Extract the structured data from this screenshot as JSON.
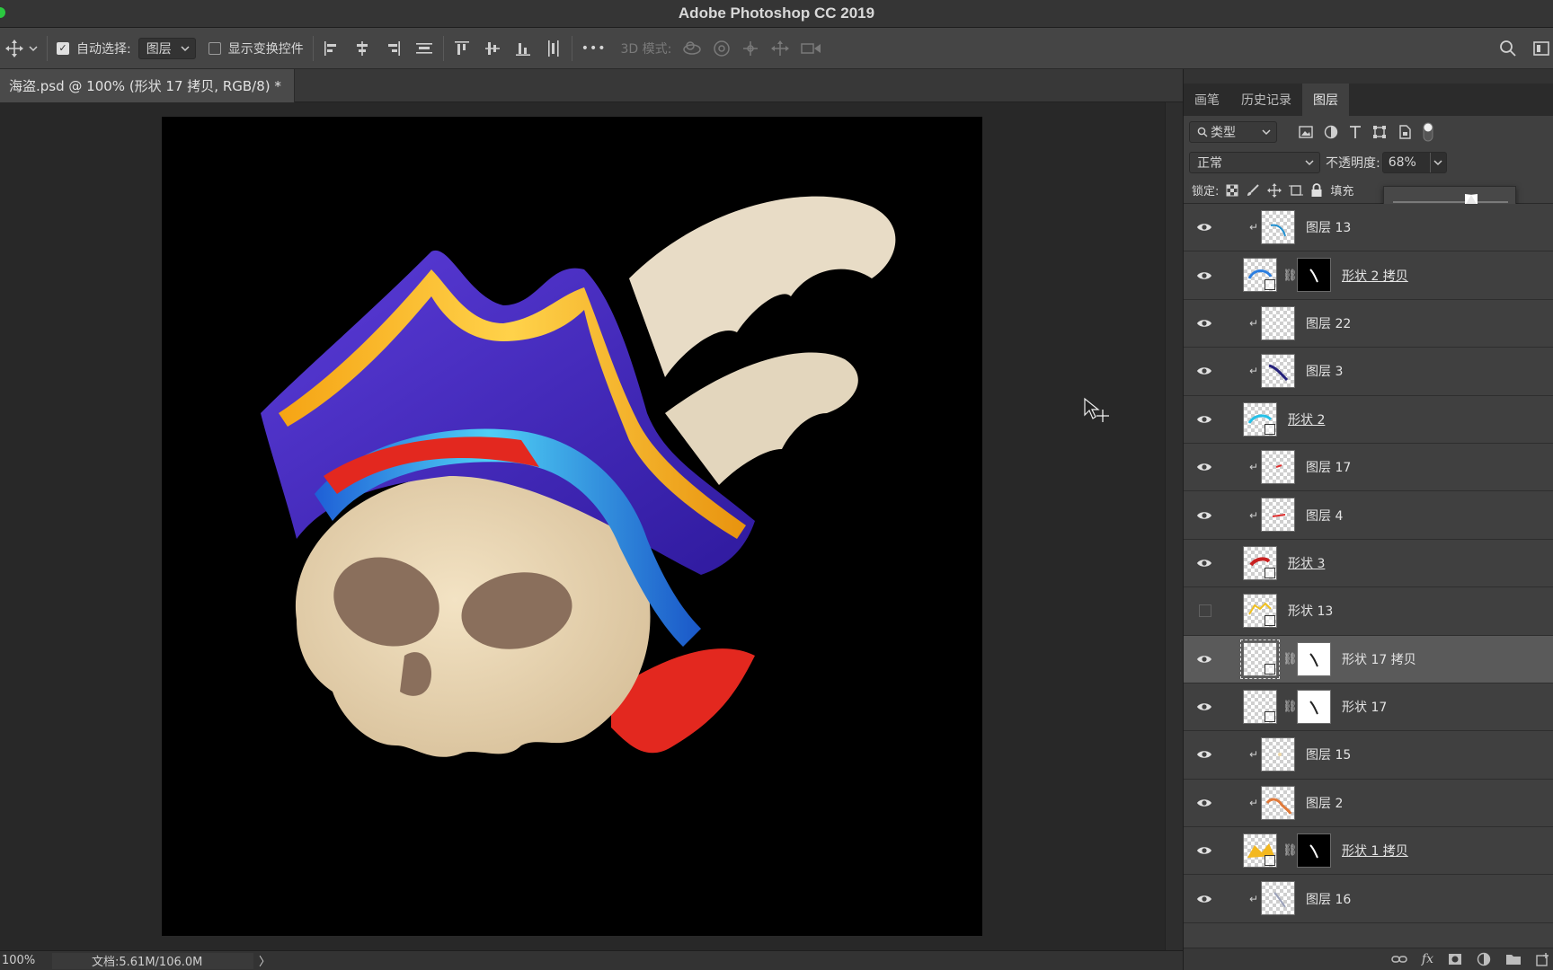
{
  "app": {
    "title": "Adobe Photoshop CC 2019"
  },
  "options_bar": {
    "auto_select_label": "自动选择:",
    "auto_select_value": "图层",
    "show_transform_label": "显示变换控件",
    "mode_3d_label": "3D 模式:",
    "more": "•••"
  },
  "document": {
    "tab_title": "海盗.psd @ 100% (形状 17 拷贝, RGB/8) *"
  },
  "status": {
    "zoom": "100%",
    "doc_size": "文档:5.61M/106.0M",
    "arrow": "〉"
  },
  "panel": {
    "tabs": [
      "画笔",
      "历史记录",
      "图层"
    ],
    "active_tab": "图层",
    "filter_kind": "类型",
    "blend_mode": "正常",
    "opacity_label": "不透明度:",
    "opacity_value": "68%",
    "opacity_level": 0.68,
    "lock_label": "锁定:",
    "fill_label": "填充"
  },
  "layers": [
    {
      "name": "图层 13",
      "visible": true,
      "clipped": true,
      "kind": "pixel",
      "thumb": "blue-stroke"
    },
    {
      "name": "形状 2 拷贝",
      "visible": true,
      "clipped": false,
      "kind": "shape-mask",
      "underlined": true,
      "mask": "black",
      "thumb": "blue-arc"
    },
    {
      "name": "图层 22",
      "visible": true,
      "clipped": true,
      "kind": "pixel",
      "thumb": "empty"
    },
    {
      "name": "图层 3",
      "visible": true,
      "clipped": true,
      "kind": "pixel",
      "thumb": "navy-stroke"
    },
    {
      "name": "形状 2",
      "visible": true,
      "clipped": false,
      "kind": "shape",
      "underlined": true,
      "thumb": "cyan-arc"
    },
    {
      "name": "图层 17",
      "visible": true,
      "clipped": true,
      "kind": "pixel",
      "thumb": "red-dot"
    },
    {
      "name": "图层 4",
      "visible": true,
      "clipped": true,
      "kind": "pixel",
      "thumb": "red-line"
    },
    {
      "name": "形状 3",
      "visible": true,
      "clipped": false,
      "kind": "shape",
      "underlined": true,
      "thumb": "red-arc"
    },
    {
      "name": "形状 13",
      "visible": false,
      "clipped": false,
      "kind": "shape",
      "thumb": "yellow-zig"
    },
    {
      "name": "形状 17 拷贝",
      "visible": true,
      "clipped": false,
      "kind": "shape-mask",
      "selected": true,
      "mask": "white",
      "thumb": "empty"
    },
    {
      "name": "形状 17",
      "visible": true,
      "clipped": false,
      "kind": "shape-mask",
      "mask": "white",
      "thumb": "empty"
    },
    {
      "name": "图层 15",
      "visible": true,
      "clipped": true,
      "kind": "pixel",
      "thumb": "cream"
    },
    {
      "name": "图层 2",
      "visible": true,
      "clipped": true,
      "kind": "pixel",
      "thumb": "orange-stroke"
    },
    {
      "name": "形状 1 拷贝",
      "visible": true,
      "clipped": false,
      "kind": "shape-mask",
      "underlined": true,
      "mask": "black",
      "thumb": "yellow-hat"
    },
    {
      "name": "图层 16",
      "visible": true,
      "clipped": true,
      "kind": "pixel",
      "thumb": "gray-stroke"
    }
  ],
  "colors": {
    "accent_blue": "#3a2fc4",
    "hat_purple": "#4a2bb8",
    "gold": "#f0a81c",
    "band_cyan": "#2d9be8",
    "scarf_red": "#e3281f",
    "skull": "#e8d6b4",
    "feather": "#e6d9c2"
  }
}
